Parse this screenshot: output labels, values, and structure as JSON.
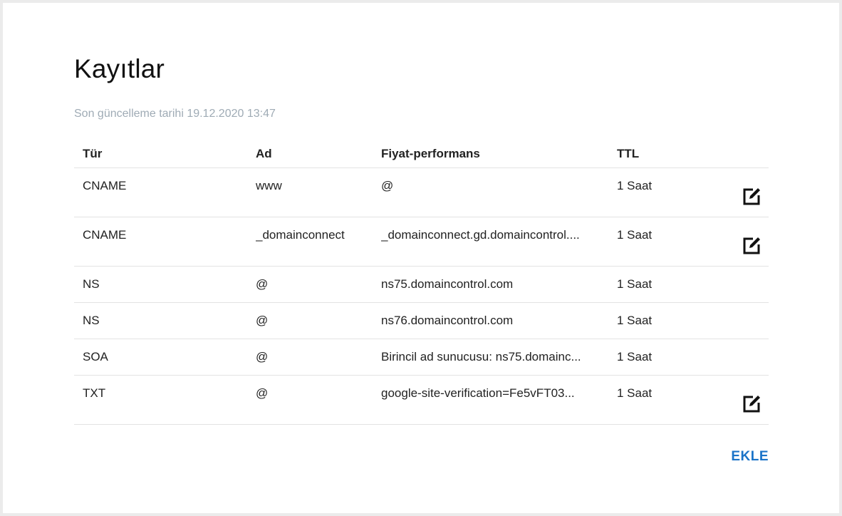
{
  "page": {
    "title": "Kayıtlar",
    "last_updated": "Son güncelleme tarihi 19.12.2020 13:47"
  },
  "table": {
    "headers": [
      "Tür",
      "Ad",
      "Fiyat-performans",
      "TTL"
    ],
    "rows": [
      {
        "type": "CNAME",
        "name": "www",
        "value": "@",
        "ttl": "1 Saat",
        "editable": true
      },
      {
        "type": "CNAME",
        "name": "_domainconnect",
        "value": "_domainconnect.gd.domaincontrol....",
        "ttl": "1 Saat",
        "editable": true
      },
      {
        "type": "NS",
        "name": "@",
        "value": "ns75.domaincontrol.com",
        "ttl": "1 Saat",
        "editable": false
      },
      {
        "type": "NS",
        "name": "@",
        "value": "ns76.domaincontrol.com",
        "ttl": "1 Saat",
        "editable": false
      },
      {
        "type": "SOA",
        "name": "@",
        "value": "Birincil ad sunucusu: ns75.domainc...",
        "ttl": "1 Saat",
        "editable": false
      },
      {
        "type": "TXT",
        "name": "@",
        "value": "google-site-verification=Fe5vFT03...",
        "ttl": "1 Saat",
        "editable": true
      }
    ]
  },
  "actions": {
    "add_label": "EKLE"
  },
  "colors": {
    "accent": "#1a73c8",
    "muted_text": "#9fabb5"
  },
  "icons": {
    "edit": "edit-icon"
  }
}
